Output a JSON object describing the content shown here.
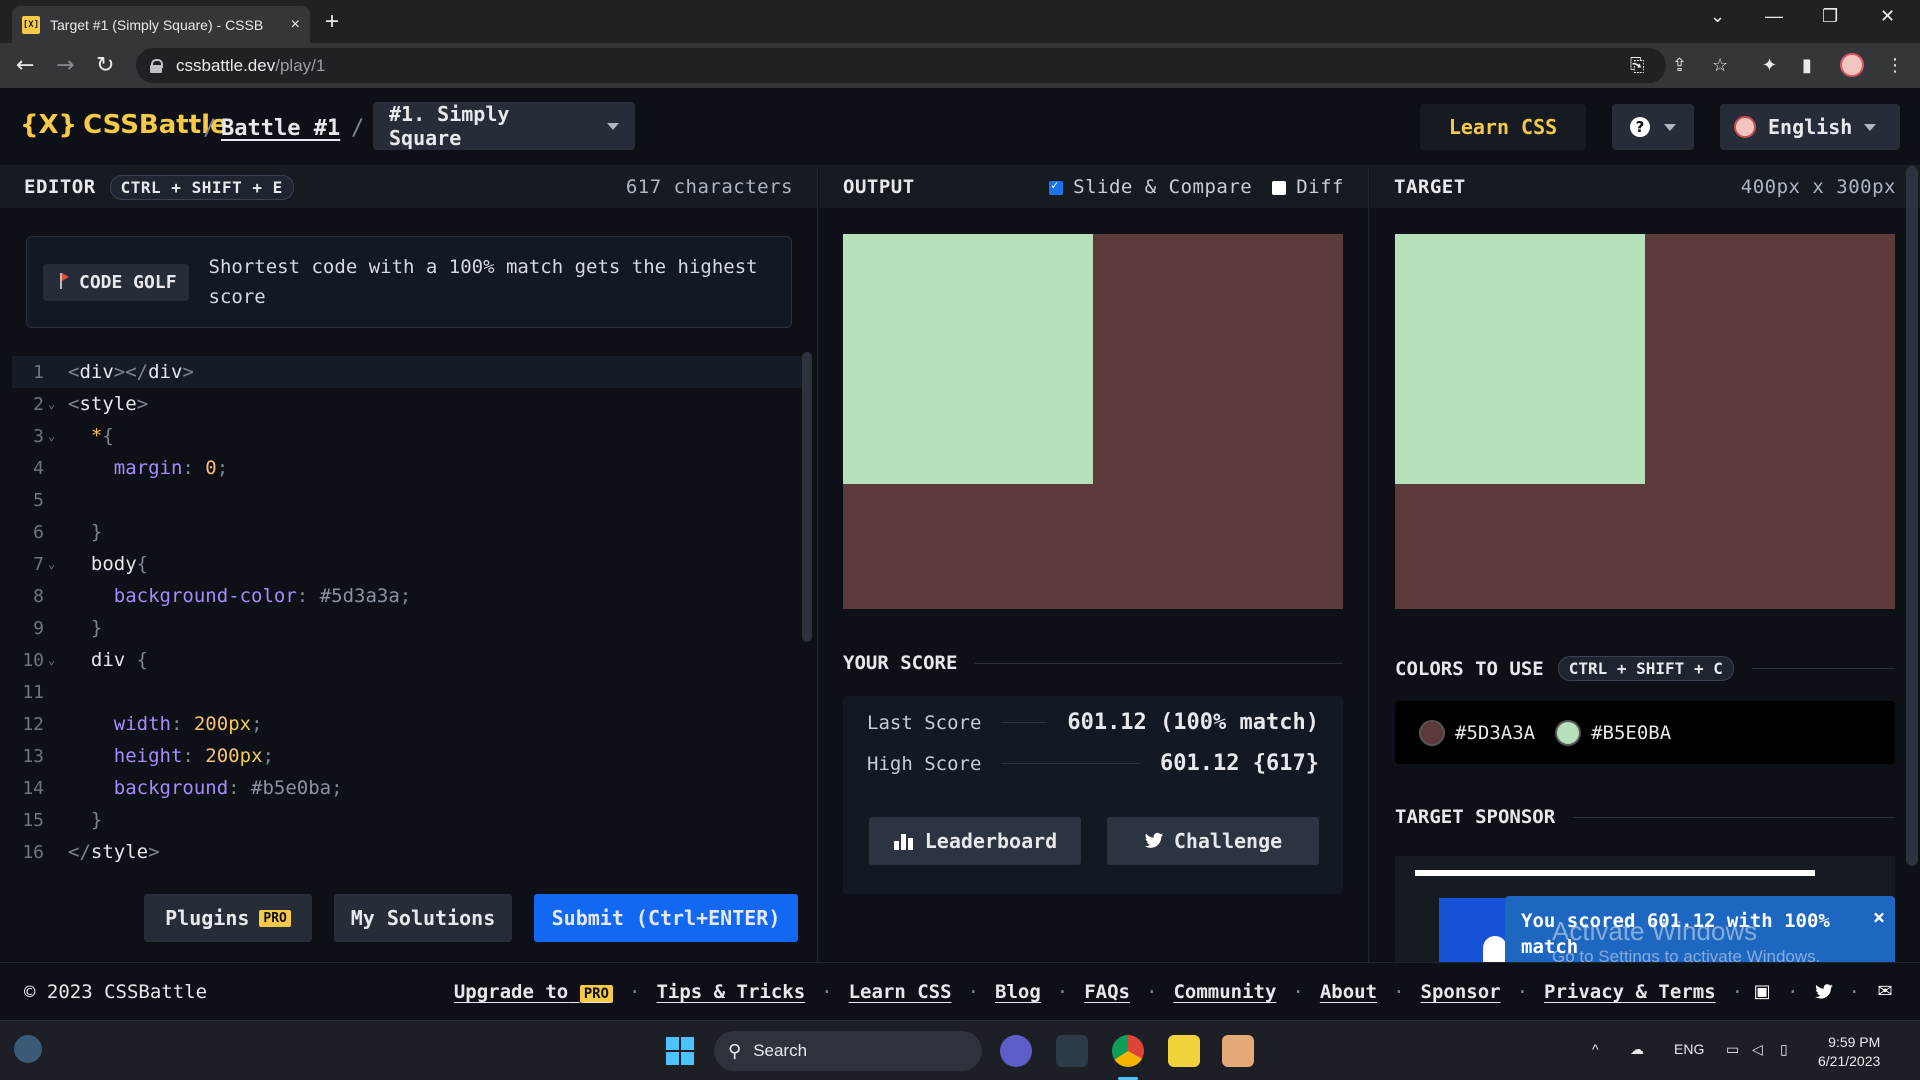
{
  "browser": {
    "tab_title": "Target #1 (Simply Square) - CSSB",
    "tab_close": "×",
    "new_tab": "+",
    "url_host": "cssbattle.dev",
    "url_path": "/play/1"
  },
  "header": {
    "logo_icon": "{X}",
    "logo_text": "CSSBattle",
    "crumb_sep": "/",
    "battle_link": "Battle #1",
    "level": "#1. Simply Square",
    "learn_css": "Learn CSS",
    "help": "?",
    "language": "English"
  },
  "editor": {
    "label": "EDITOR",
    "shortcut": "CTRL + SHIFT + E",
    "char_count": "617 characters",
    "golf_badge": "CODE GOLF",
    "golf_text": "Shortest code with a 100% match gets the highest score",
    "lines": [
      {
        "n": "1",
        "fold": false,
        "html": [
          [
            "tok-p",
            "<"
          ],
          [
            "tok-tag",
            "div"
          ],
          [
            "tok-p",
            "></"
          ],
          [
            "tok-tag",
            "div"
          ],
          [
            "tok-p",
            ">"
          ]
        ]
      },
      {
        "n": "2",
        "fold": true,
        "html": [
          [
            "tok-p",
            "<"
          ],
          [
            "tok-tag",
            "style"
          ],
          [
            "tok-p",
            ">"
          ]
        ]
      },
      {
        "n": "3",
        "fold": true,
        "html": [
          [
            "",
            "  "
          ],
          [
            "tok-sel",
            "*"
          ],
          [
            "tok-p",
            "{"
          ]
        ]
      },
      {
        "n": "4",
        "fold": false,
        "html": [
          [
            "",
            "    "
          ],
          [
            "tok-prop",
            "margin"
          ],
          [
            "tok-p",
            ": "
          ],
          [
            "tok-num",
            "0"
          ],
          [
            "tok-p",
            ";"
          ]
        ]
      },
      {
        "n": "5",
        "fold": false,
        "html": []
      },
      {
        "n": "6",
        "fold": false,
        "html": [
          [
            "",
            "  "
          ],
          [
            "tok-p",
            "}"
          ]
        ]
      },
      {
        "n": "7",
        "fold": true,
        "html": [
          [
            "",
            "  "
          ],
          [
            "tok-tag",
            "body"
          ],
          [
            "tok-p",
            "{"
          ]
        ]
      },
      {
        "n": "8",
        "fold": false,
        "html": [
          [
            "",
            "    "
          ],
          [
            "tok-prop",
            "background-color"
          ],
          [
            "tok-p",
            ": "
          ],
          [
            "tok-str",
            "#5d3a3a"
          ],
          [
            "tok-p",
            ";"
          ]
        ]
      },
      {
        "n": "9",
        "fold": false,
        "html": [
          [
            "",
            "  "
          ],
          [
            "tok-p",
            "}"
          ]
        ]
      },
      {
        "n": "10",
        "fold": true,
        "html": [
          [
            "",
            "  "
          ],
          [
            "tok-tag",
            "div "
          ],
          [
            "tok-p",
            "{"
          ]
        ]
      },
      {
        "n": "11",
        "fold": false,
        "html": []
      },
      {
        "n": "12",
        "fold": false,
        "html": [
          [
            "",
            "    "
          ],
          [
            "tok-prop",
            "width"
          ],
          [
            "tok-p",
            ": "
          ],
          [
            "tok-num",
            "200"
          ],
          [
            "tok-sel",
            "px"
          ],
          [
            "tok-p",
            ";"
          ]
        ]
      },
      {
        "n": "13",
        "fold": false,
        "html": [
          [
            "",
            "    "
          ],
          [
            "tok-prop",
            "height"
          ],
          [
            "tok-p",
            ": "
          ],
          [
            "tok-num",
            "200"
          ],
          [
            "tok-sel",
            "px"
          ],
          [
            "tok-p",
            ";"
          ]
        ]
      },
      {
        "n": "14",
        "fold": false,
        "html": [
          [
            "",
            "    "
          ],
          [
            "tok-prop",
            "background"
          ],
          [
            "tok-p",
            ": "
          ],
          [
            "tok-str",
            "#b5e0ba"
          ],
          [
            "tok-p",
            ";"
          ]
        ]
      },
      {
        "n": "15",
        "fold": false,
        "html": [
          [
            "",
            "  "
          ],
          [
            "tok-p",
            "}"
          ]
        ]
      },
      {
        "n": "16",
        "fold": false,
        "html": [
          [
            "tok-p",
            "</"
          ],
          [
            "tok-tag",
            "style"
          ],
          [
            "tok-p",
            ">"
          ]
        ]
      }
    ],
    "plugins": "Plugins",
    "pro": "PRO",
    "my_solutions": "My Solutions",
    "submit": "Submit (Ctrl+ENTER)"
  },
  "output": {
    "label": "OUTPUT",
    "slide_compare": "Slide & Compare",
    "slide_compare_checked": true,
    "diff": "Diff",
    "diff_checked": false,
    "your_score": "YOUR SCORE",
    "last_score_label": "Last Score",
    "last_score_value": "601.12 (100% match)",
    "high_score_label": "High Score",
    "high_score_value": "601.12 {617}",
    "leaderboard": "Leaderboard",
    "challenge": "Challenge"
  },
  "target": {
    "label": "TARGET",
    "size": "400px x 300px",
    "colors_title": "COLORS TO USE",
    "colors_shortcut": "CTRL + SHIFT + C",
    "colors": [
      {
        "hex": "#5D3A3A",
        "swatch": "#5d3a3a"
      },
      {
        "hex": "#B5E0BA",
        "swatch": "#b5e0ba"
      }
    ],
    "sponsor_title": "TARGET SPONSOR"
  },
  "canvas": {
    "background": "#5d3a3a",
    "square": "#b5e0ba"
  },
  "toast": {
    "text": "You scored 601.12 with 100% match",
    "close": "×"
  },
  "watermark": {
    "line1": "Activate Windows",
    "line2": "Go to Settings to activate Windows."
  },
  "footer": {
    "copyright": "© 2023 CSSBattle",
    "upgrade": "Upgrade to",
    "pro": "PRO",
    "links": [
      "Tips & Tricks",
      "Learn CSS",
      "Blog",
      "FAQs",
      "Community",
      "About",
      "Sponsor",
      "Privacy & Terms"
    ]
  },
  "taskbar": {
    "search": "Search",
    "lang": "ENG",
    "time": "9:59 PM",
    "date": "6/21/2023"
  }
}
